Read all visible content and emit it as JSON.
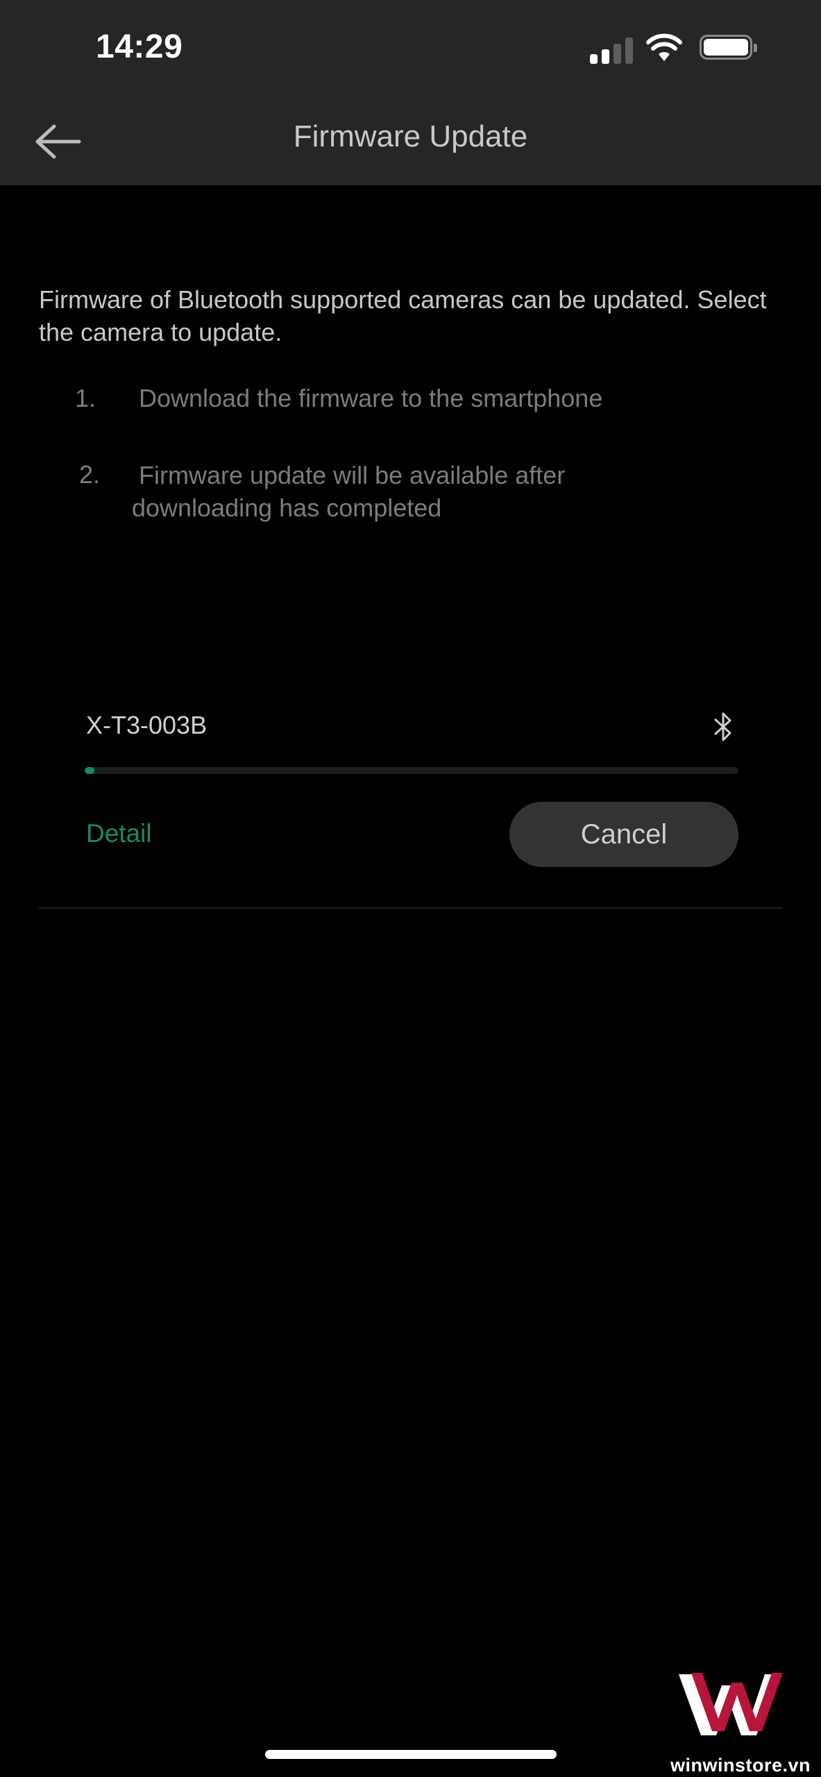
{
  "status_bar": {
    "time": "14:29",
    "signal_bars_active": 2,
    "signal_bars_total": 4,
    "wifi": "wifi-icon",
    "battery": "battery-full-icon"
  },
  "header": {
    "back_icon": "arrow-left-icon",
    "title": "Firmware Update"
  },
  "description": "Firmware of Bluetooth supported cameras can be updated. Select the camera to update.",
  "steps": [
    {
      "number": "1.",
      "text": "Download the firmware to the smartphone"
    },
    {
      "number": "2.",
      "text": "Firmware update will be available after",
      "text_cont": "downloading has completed"
    }
  ],
  "device": {
    "name": "X-T3-003B",
    "connection_icon": "bluetooth-icon",
    "progress_percent": 1.5,
    "detail_label": "Detail",
    "cancel_label": "Cancel"
  },
  "colors": {
    "accent": "#1a8a66",
    "header_bg": "#262626",
    "button_bg": "#333333",
    "background": "#000000"
  },
  "watermark": {
    "text": "winwinstore.vn",
    "icon": "winwin-logo-icon"
  }
}
